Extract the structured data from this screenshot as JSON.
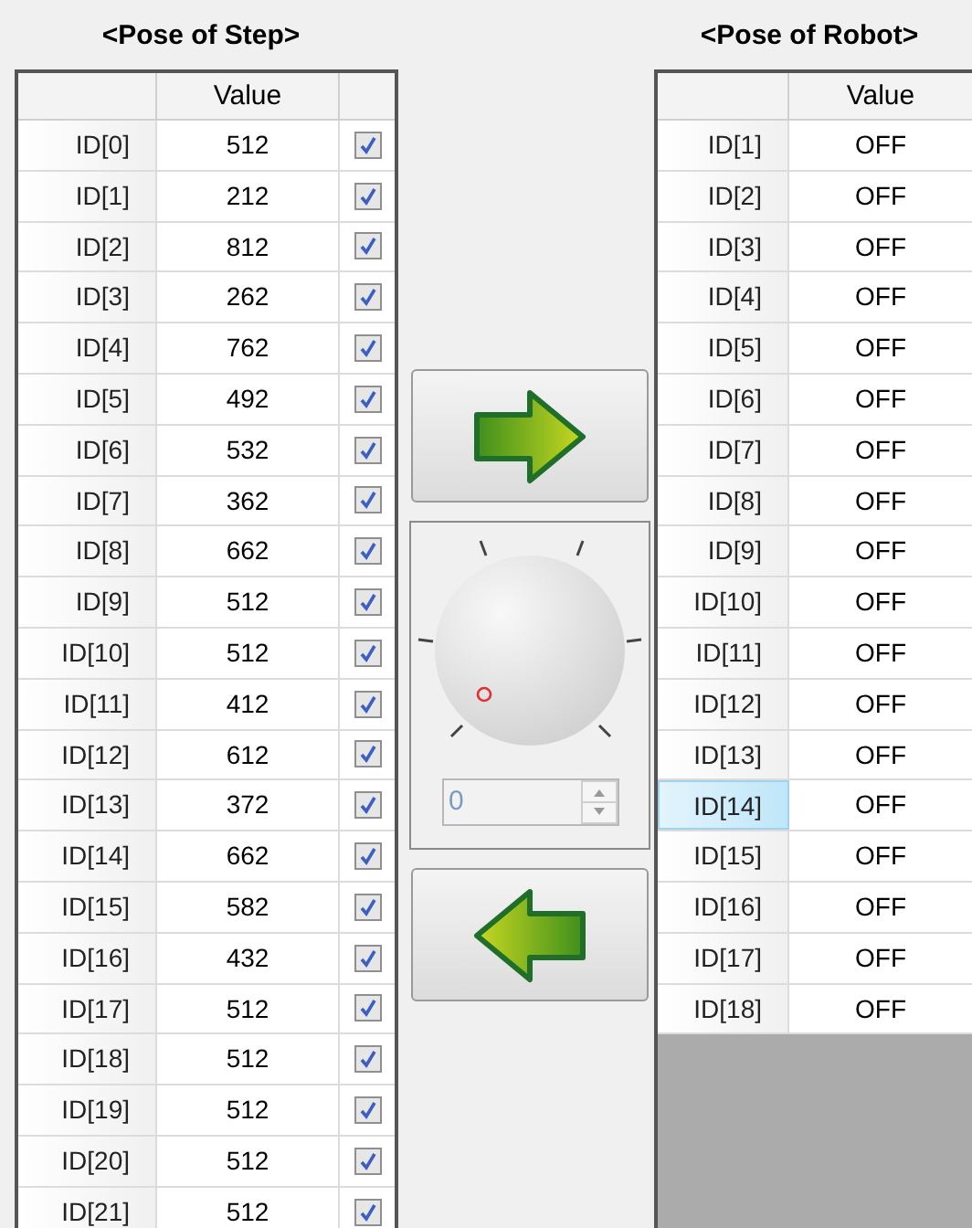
{
  "step_panel": {
    "title": "<Pose of Step>",
    "columns": [
      "Value"
    ],
    "rows": [
      {
        "id": "ID[0]",
        "value": "512",
        "checked": true
      },
      {
        "id": "ID[1]",
        "value": "212",
        "checked": true
      },
      {
        "id": "ID[2]",
        "value": "812",
        "checked": true
      },
      {
        "id": "ID[3]",
        "value": "262",
        "checked": true
      },
      {
        "id": "ID[4]",
        "value": "762",
        "checked": true
      },
      {
        "id": "ID[5]",
        "value": "492",
        "checked": true
      },
      {
        "id": "ID[6]",
        "value": "532",
        "checked": true
      },
      {
        "id": "ID[7]",
        "value": "362",
        "checked": true
      },
      {
        "id": "ID[8]",
        "value": "662",
        "checked": true
      },
      {
        "id": "ID[9]",
        "value": "512",
        "checked": true
      },
      {
        "id": "ID[10]",
        "value": "512",
        "checked": true
      },
      {
        "id": "ID[11]",
        "value": "412",
        "checked": true
      },
      {
        "id": "ID[12]",
        "value": "612",
        "checked": true
      },
      {
        "id": "ID[13]",
        "value": "372",
        "checked": true
      },
      {
        "id": "ID[14]",
        "value": "662",
        "checked": true
      },
      {
        "id": "ID[15]",
        "value": "582",
        "checked": true
      },
      {
        "id": "ID[16]",
        "value": "432",
        "checked": true
      },
      {
        "id": "ID[17]",
        "value": "512",
        "checked": true
      },
      {
        "id": "ID[18]",
        "value": "512",
        "checked": true
      },
      {
        "id": "ID[19]",
        "value": "512",
        "checked": true
      },
      {
        "id": "ID[20]",
        "value": "512",
        "checked": true
      },
      {
        "id": "ID[21]",
        "value": "512",
        "checked": true
      }
    ]
  },
  "controls": {
    "spin_value": "0"
  },
  "robot_panel": {
    "title": "<Pose of Robot>",
    "columns": [
      "Value"
    ],
    "rows": [
      {
        "id": "ID[1]",
        "value": "OFF",
        "selected": false
      },
      {
        "id": "ID[2]",
        "value": "OFF",
        "selected": false
      },
      {
        "id": "ID[3]",
        "value": "OFF",
        "selected": false
      },
      {
        "id": "ID[4]",
        "value": "OFF",
        "selected": false
      },
      {
        "id": "ID[5]",
        "value": "OFF",
        "selected": false
      },
      {
        "id": "ID[6]",
        "value": "OFF",
        "selected": false
      },
      {
        "id": "ID[7]",
        "value": "OFF",
        "selected": false
      },
      {
        "id": "ID[8]",
        "value": "OFF",
        "selected": false
      },
      {
        "id": "ID[9]",
        "value": "OFF",
        "selected": false
      },
      {
        "id": "ID[10]",
        "value": "OFF",
        "selected": false
      },
      {
        "id": "ID[11]",
        "value": "OFF",
        "selected": false
      },
      {
        "id": "ID[12]",
        "value": "OFF",
        "selected": false
      },
      {
        "id": "ID[13]",
        "value": "OFF",
        "selected": false
      },
      {
        "id": "ID[14]",
        "value": "OFF",
        "selected": true
      },
      {
        "id": "ID[15]",
        "value": "OFF",
        "selected": false
      },
      {
        "id": "ID[16]",
        "value": "OFF",
        "selected": false
      },
      {
        "id": "ID[17]",
        "value": "OFF",
        "selected": false
      },
      {
        "id": "ID[18]",
        "value": "OFF",
        "selected": false
      }
    ]
  }
}
